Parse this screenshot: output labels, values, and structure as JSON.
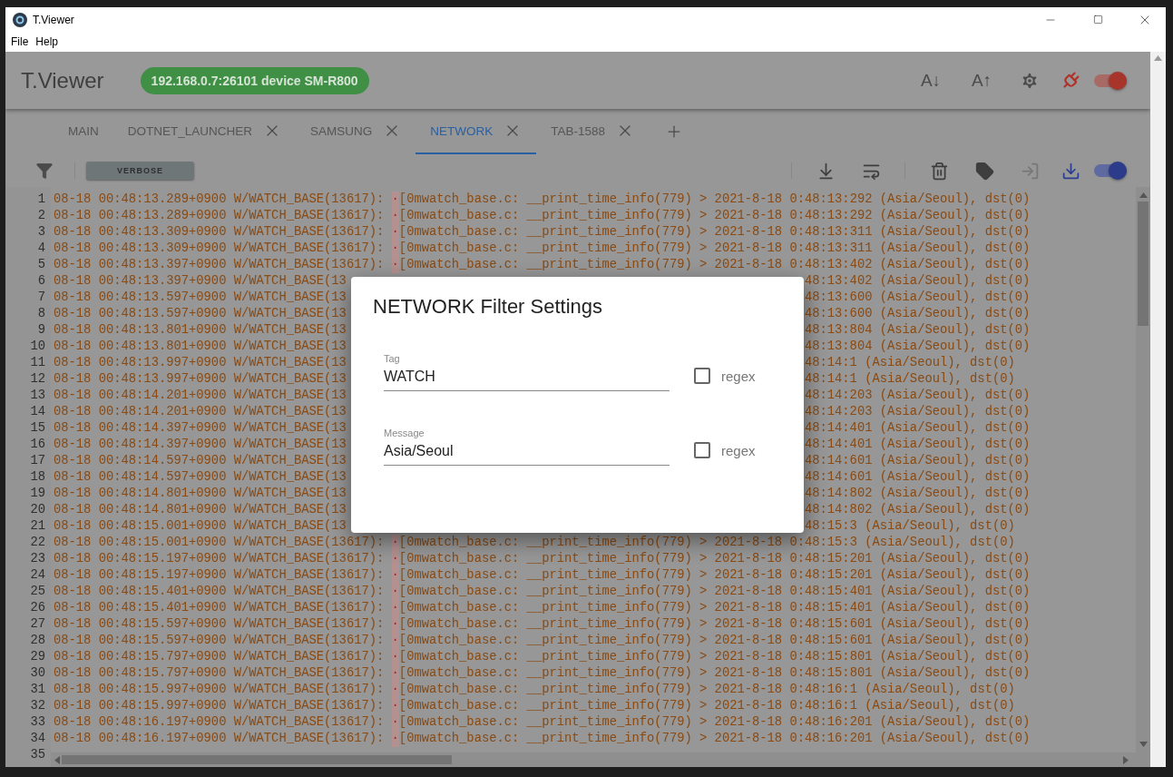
{
  "window": {
    "title": "T.Viewer"
  },
  "menu": [
    "File",
    "Help"
  ],
  "header": {
    "title": "T.Viewer",
    "device": "192.168.0.7:26101 device SM-R800",
    "font_down": "A↓",
    "font_up": "A↑",
    "connection_switch": {
      "on": true
    }
  },
  "tabs": [
    {
      "label": "MAIN",
      "closable": false,
      "selected": false
    },
    {
      "label": "DOTNET_LAUNCHER",
      "closable": true,
      "selected": false
    },
    {
      "label": "SAMSUNG",
      "closable": true,
      "selected": false
    },
    {
      "label": "NETWORK",
      "closable": true,
      "selected": true
    },
    {
      "label": "TAB-1588",
      "closable": true,
      "selected": false
    }
  ],
  "toolbar": {
    "level_chip": "VERBOSE",
    "actions": [
      {
        "disabled": false
      },
      {
        "disabled": false
      },
      {
        "disabled": false
      },
      {
        "disabled": false
      },
      {
        "disabled": true
      },
      {
        "disabled": false
      }
    ],
    "follow_switch": {
      "on": true
    }
  },
  "log": [
    {
      "number": "1",
      "kind": "full",
      "source": "08-18 00:48:13.289+0900 W/WATCH_BASE(13617):",
      "marker": "·",
      "message": "[0mwatch_base.c: __print_time_info(779) > 2021-8-18 0:48:13:292 (Asia/Seoul), dst(0)"
    },
    {
      "number": "2",
      "kind": "full",
      "source": "08-18 00:48:13.289+0900 W/WATCH_BASE(13617):",
      "marker": "·",
      "message": "[0mwatch_base.c: __print_time_info(779) > 2021-8-18 0:48:13:292 (Asia/Seoul), dst(0)"
    },
    {
      "number": "3",
      "kind": "full",
      "source": "08-18 00:48:13.309+0900 W/WATCH_BASE(13617):",
      "marker": "·",
      "message": "[0mwatch_base.c: __print_time_info(779) > 2021-8-18 0:48:13:311 (Asia/Seoul), dst(0)"
    },
    {
      "number": "4",
      "kind": "full",
      "source": "08-18 00:48:13.309+0900 W/WATCH_BASE(13617):",
      "marker": "·",
      "message": "[0mwatch_base.c: __print_time_info(779) > 2021-8-18 0:48:13:311 (Asia/Seoul), dst(0)"
    },
    {
      "number": "5",
      "kind": "full",
      "source": "08-18 00:48:13.397+0900 W/WATCH_BASE(13617):",
      "marker": "·",
      "message": "[0mwatch_base.c: __print_time_info(779) > 2021-8-18 0:48:13:402 (Asia/Seoul), dst(0)"
    },
    {
      "number": "6",
      "kind": "covered",
      "left": "08-18 00:48:13.397+0900 W/WATCH_BASE(13",
      "right": "48:13:402 (Asia/Seoul), dst(0)"
    },
    {
      "number": "7",
      "kind": "covered",
      "left": "08-18 00:48:13.597+0900 W/WATCH_BASE(13",
      "right": "48:13:600 (Asia/Seoul), dst(0)"
    },
    {
      "number": "8",
      "kind": "covered",
      "left": "08-18 00:48:13.597+0900 W/WATCH_BASE(13",
      "right": "48:13:600 (Asia/Seoul), dst(0)"
    },
    {
      "number": "9",
      "kind": "covered",
      "left": "08-18 00:48:13.801+0900 W/WATCH_BASE(13",
      "right": "48:13:804 (Asia/Seoul), dst(0)"
    },
    {
      "number": "10",
      "kind": "covered",
      "left": "08-18 00:48:13.801+0900 W/WATCH_BASE(13",
      "right": "48:13:804 (Asia/Seoul), dst(0)"
    },
    {
      "number": "11",
      "kind": "covered",
      "left": "08-18 00:48:13.997+0900 W/WATCH_BASE(13",
      "right": "48:14:1 (Asia/Seoul), dst(0)"
    },
    {
      "number": "12",
      "kind": "covered",
      "left": "08-18 00:48:13.997+0900 W/WATCH_BASE(13",
      "right": "48:14:1 (Asia/Seoul), dst(0)"
    },
    {
      "number": "13",
      "kind": "covered",
      "left": "08-18 00:48:14.201+0900 W/WATCH_BASE(13",
      "right": "48:14:203 (Asia/Seoul), dst(0)"
    },
    {
      "number": "14",
      "kind": "covered",
      "left": "08-18 00:48:14.201+0900 W/WATCH_BASE(13",
      "right": "48:14:203 (Asia/Seoul), dst(0)"
    },
    {
      "number": "15",
      "kind": "covered",
      "left": "08-18 00:48:14.397+0900 W/WATCH_BASE(13",
      "right": "48:14:401 (Asia/Seoul), dst(0)"
    },
    {
      "number": "16",
      "kind": "covered",
      "left": "08-18 00:48:14.397+0900 W/WATCH_BASE(13",
      "right": "48:14:401 (Asia/Seoul), dst(0)"
    },
    {
      "number": "17",
      "kind": "covered",
      "left": "08-18 00:48:14.597+0900 W/WATCH_BASE(13",
      "right": "48:14:601 (Asia/Seoul), dst(0)"
    },
    {
      "number": "18",
      "kind": "covered",
      "left": "08-18 00:48:14.597+0900 W/WATCH_BASE(13",
      "right": "48:14:601 (Asia/Seoul), dst(0)"
    },
    {
      "number": "19",
      "kind": "covered",
      "left": "08-18 00:48:14.801+0900 W/WATCH_BASE(13",
      "right": "48:14:802 (Asia/Seoul), dst(0)"
    },
    {
      "number": "20",
      "kind": "covered",
      "left": "08-18 00:48:14.801+0900 W/WATCH_BASE(13",
      "right": "48:14:802 (Asia/Seoul), dst(0)"
    },
    {
      "number": "21",
      "kind": "covered",
      "left": "08-18 00:48:15.001+0900 W/WATCH_BASE(13",
      "right": "48:15:3 (Asia/Seoul), dst(0)"
    },
    {
      "number": "22",
      "kind": "full",
      "source": "08-18 00:48:15.001+0900 W/WATCH_BASE(13617):",
      "marker": "·",
      "message": "[0mwatch_base.c: __print_time_info(779) > 2021-8-18 0:48:15:3 (Asia/Seoul), dst(0)"
    },
    {
      "number": "23",
      "kind": "full",
      "source": "08-18 00:48:15.197+0900 W/WATCH_BASE(13617):",
      "marker": "·",
      "message": "[0mwatch_base.c: __print_time_info(779) > 2021-8-18 0:48:15:201 (Asia/Seoul), dst(0)"
    },
    {
      "number": "24",
      "kind": "full",
      "source": "08-18 00:48:15.197+0900 W/WATCH_BASE(13617):",
      "marker": "·",
      "message": "[0mwatch_base.c: __print_time_info(779) > 2021-8-18 0:48:15:201 (Asia/Seoul), dst(0)"
    },
    {
      "number": "25",
      "kind": "full",
      "source": "08-18 00:48:15.401+0900 W/WATCH_BASE(13617):",
      "marker": "·",
      "message": "[0mwatch_base.c: __print_time_info(779) > 2021-8-18 0:48:15:401 (Asia/Seoul), dst(0)"
    },
    {
      "number": "26",
      "kind": "full",
      "source": "08-18 00:48:15.401+0900 W/WATCH_BASE(13617):",
      "marker": "·",
      "message": "[0mwatch_base.c: __print_time_info(779) > 2021-8-18 0:48:15:401 (Asia/Seoul), dst(0)"
    },
    {
      "number": "27",
      "kind": "full",
      "source": "08-18 00:48:15.597+0900 W/WATCH_BASE(13617):",
      "marker": "·",
      "message": "[0mwatch_base.c: __print_time_info(779) > 2021-8-18 0:48:15:601 (Asia/Seoul), dst(0)"
    },
    {
      "number": "28",
      "kind": "full",
      "source": "08-18 00:48:15.597+0900 W/WATCH_BASE(13617):",
      "marker": "·",
      "message": "[0mwatch_base.c: __print_time_info(779) > 2021-8-18 0:48:15:601 (Asia/Seoul), dst(0)"
    },
    {
      "number": "29",
      "kind": "full",
      "source": "08-18 00:48:15.797+0900 W/WATCH_BASE(13617):",
      "marker": "·",
      "message": "[0mwatch_base.c: __print_time_info(779) > 2021-8-18 0:48:15:801 (Asia/Seoul), dst(0)"
    },
    {
      "number": "30",
      "kind": "full",
      "source": "08-18 00:48:15.797+0900 W/WATCH_BASE(13617):",
      "marker": "·",
      "message": "[0mwatch_base.c: __print_time_info(779) > 2021-8-18 0:48:15:801 (Asia/Seoul), dst(0)"
    },
    {
      "number": "31",
      "kind": "full",
      "source": "08-18 00:48:15.997+0900 W/WATCH_BASE(13617):",
      "marker": "·",
      "message": "[0mwatch_base.c: __print_time_info(779) > 2021-8-18 0:48:16:1 (Asia/Seoul), dst(0)"
    },
    {
      "number": "32",
      "kind": "full",
      "source": "08-18 00:48:15.997+0900 W/WATCH_BASE(13617):",
      "marker": "·",
      "message": "[0mwatch_base.c: __print_time_info(779) > 2021-8-18 0:48:16:1 (Asia/Seoul), dst(0)"
    },
    {
      "number": "33",
      "kind": "full",
      "source": "08-18 00:48:16.197+0900 W/WATCH_BASE(13617):",
      "marker": "·",
      "message": "[0mwatch_base.c: __print_time_info(779) > 2021-8-18 0:48:16:201 (Asia/Seoul), dst(0)"
    },
    {
      "number": "34",
      "kind": "full",
      "source": "08-18 00:48:16.197+0900 W/WATCH_BASE(13617):",
      "marker": "·",
      "message": "[0mwatch_base.c: __print_time_info(779) > 2021-8-18 0:48:16:201 (Asia/Seoul), dst(0)"
    },
    {
      "number": "35",
      "kind": "hidden"
    }
  ],
  "dialog": {
    "title": "NETWORK Filter Settings",
    "fields": [
      {
        "label": "Tag",
        "value": "WATCH",
        "regex": {
          "label": "regex",
          "checked": false
        }
      },
      {
        "label": "Message",
        "value": "Asia/Seoul",
        "regex": {
          "label": "regex",
          "checked": false
        }
      }
    ]
  }
}
